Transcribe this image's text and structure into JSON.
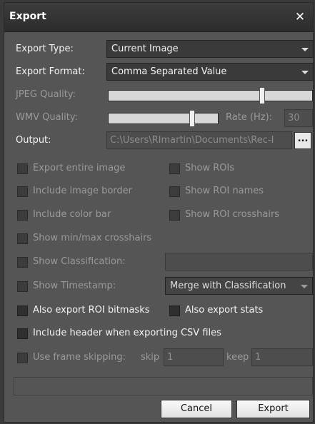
{
  "dialog": {
    "title": "Export"
  },
  "fields": {
    "export_type_label": "Export Type:",
    "export_type_value": "Current Image",
    "export_format_label": "Export Format:",
    "export_format_value": "Comma Separated Value",
    "jpeg_quality_label": "JPEG Quality:",
    "jpeg_quality_level": 0.75,
    "wmv_quality_label": "WMV Quality:",
    "wmv_quality_level": 0.75,
    "rate_label": "Rate (Hz):",
    "rate_value": "30",
    "output_label": "Output:",
    "output_value": "C:\\Users\\RImartin\\Documents\\Rec-I",
    "browse_label": "..."
  },
  "options": {
    "export_entire_image": "Export entire image",
    "show_rois": "Show ROIs",
    "include_image_border": "Include image border",
    "show_roi_names": "Show ROI names",
    "include_color_bar": "Include color bar",
    "show_roi_crosshairs": "Show ROI crosshairs",
    "show_minmax_crosshairs": "Show min/max crosshairs",
    "show_classification": "Show Classification:",
    "show_timestamp": "Show Timestamp:",
    "timestamp_mode": "Merge with Classification",
    "also_export_roi_bitmasks": "Also export ROI bitmasks",
    "also_export_stats": "Also export stats",
    "include_header_csv": "Include header when exporting CSV files",
    "use_frame_skipping": "Use frame skipping:",
    "skip_label": "skip",
    "skip_value": "1",
    "keep_label": "keep",
    "keep_value": "1"
  },
  "buttons": {
    "cancel": "Cancel",
    "export": "Export"
  },
  "colors": {
    "window_bg": "#555555",
    "titlebar_bg": "#2c2c2c",
    "disabled_text": "#9a9a9a"
  }
}
